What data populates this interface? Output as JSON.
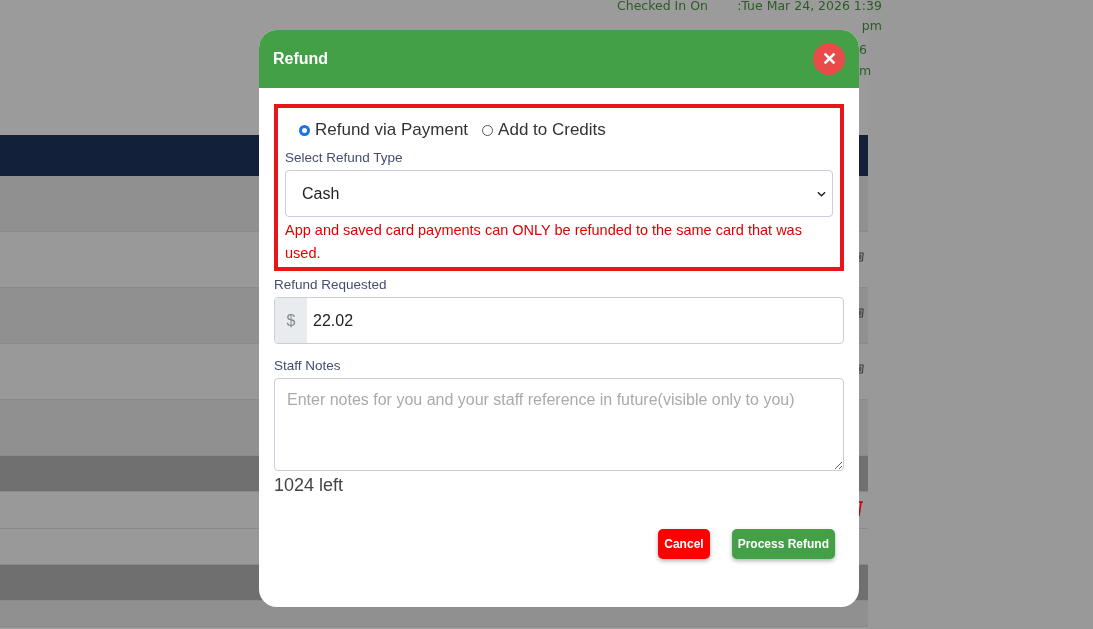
{
  "background": {
    "checked_in_label": "Checked In On",
    "checked_in_value": ":Tue Mar 24, 2026 1:39 pm",
    "second_value_fragments": [
      "6",
      "m"
    ]
  },
  "dialog": {
    "title": "Refund",
    "close_glyph": "✕",
    "refund_methods": [
      {
        "label": "Refund via Payment",
        "selected": true
      },
      {
        "label": "Add to Credits",
        "selected": false
      }
    ],
    "refund_type_label": "Select Refund Type",
    "refund_type_value": "Cash",
    "warning": "App and saved card payments can ONLY be refunded to the same card that was used.",
    "amount_label": "Refund Requested",
    "currency": "$",
    "amount_value": "22.02",
    "notes_label": "Staff Notes",
    "notes_placeholder": "Enter notes for you and your staff reference in future(visible only to you)",
    "chars_left": "1024 left",
    "buttons": [
      {
        "label": "Cancel",
        "kind": "cancel"
      },
      {
        "label": "Process Refund",
        "kind": "primary"
      }
    ]
  }
}
